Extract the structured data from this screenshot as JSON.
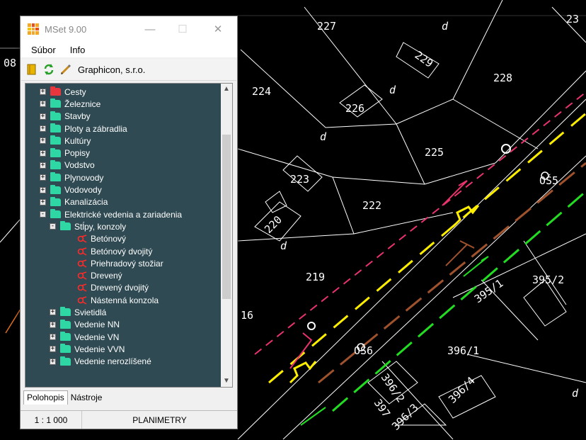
{
  "window": {
    "title": "MSet 9.00",
    "minimize": "—",
    "maximize": "☐",
    "close": "✕"
  },
  "menu": {
    "file": "Súbor",
    "info": "Info"
  },
  "toolbar": {
    "company": "Graphicon, s.r.o."
  },
  "tree": {
    "categories": [
      {
        "label": "Cesty",
        "color": "#e8363f"
      },
      {
        "label": "Železnice"
      },
      {
        "label": "Stavby"
      },
      {
        "label": "Ploty a zábradlia"
      },
      {
        "label": "Kultúry"
      },
      {
        "label": "Popisy"
      },
      {
        "label": "Vodstvo"
      },
      {
        "label": "Plynovody"
      },
      {
        "label": "Vodovody"
      },
      {
        "label": "Kanalizácia"
      },
      {
        "label": "Elektrické vedenia a zariadenia"
      }
    ],
    "subgroup": "Stĺpy, konzoly",
    "leaves": [
      "Betónový",
      "Betónový dvojitý",
      "Priehradový stožiar",
      "Drevený",
      "Drevený dvojitý",
      "Nástenná konzola"
    ],
    "sub_categories": [
      "Svietidlá",
      "Vedenie NN",
      "Vedenie VN",
      "Vedenie VVN",
      "Vedenie nerozlíšené"
    ]
  },
  "tabs": {
    "first": "Polohopis",
    "second": "Nástroje"
  },
  "status": {
    "scale": "1 : 1 000",
    "mode": "PLANIMETRY"
  },
  "map_labels": {
    "p227": "227",
    "p228": "228",
    "p229": "229",
    "p23x": "23",
    "p224": "224",
    "p226": "226",
    "p225": "225",
    "p223": "223",
    "p222": "222",
    "p220": "220",
    "p219": "219",
    "p216": "16",
    "os5": "OŠ5",
    "os6": "OŠ6",
    "p395_1": "395/1",
    "p395_2": "395/2",
    "p396_1": "396/1",
    "p396_2": "396/2",
    "p397": "397",
    "p396_3": "396/3",
    "p396_4": "396/4",
    "p08": "08",
    "d": "d"
  }
}
